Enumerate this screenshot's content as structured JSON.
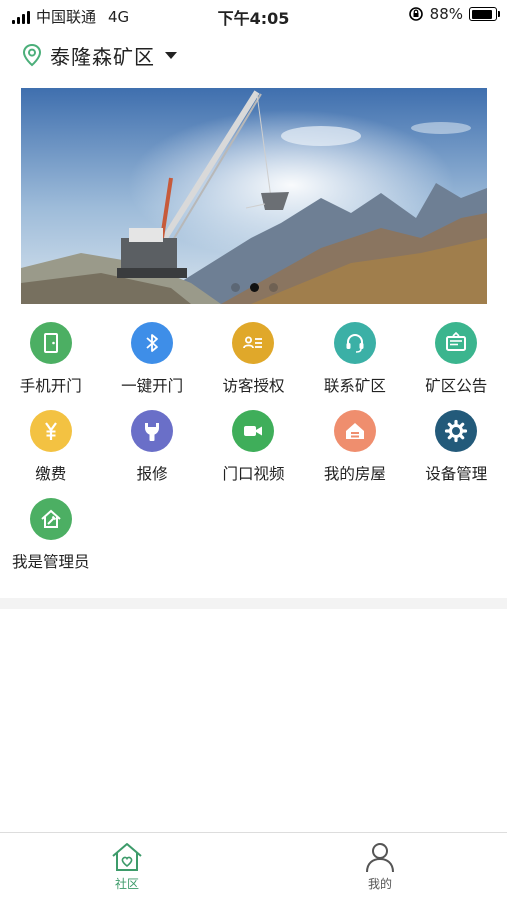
{
  "status": {
    "carrier": "中国联通",
    "network": "4G",
    "time": "下午4:05",
    "battery": "88%",
    "battery_level": 0.88
  },
  "header": {
    "location": "泰隆森矿区"
  },
  "banner": {
    "slide_count": 3,
    "active_index": 1
  },
  "grid": {
    "items": [
      {
        "label": "手机开门",
        "icon": "phone-door-icon",
        "color": "#4caf63"
      },
      {
        "label": "一键开门",
        "icon": "bluetooth-icon",
        "color": "#3e8ee8"
      },
      {
        "label": "访客授权",
        "icon": "visitor-card-icon",
        "color": "#e0a82a"
      },
      {
        "label": "联系矿区",
        "icon": "headset-icon",
        "color": "#3bb0a6"
      },
      {
        "label": "矿区公告",
        "icon": "notice-board-icon",
        "color": "#3bb58e"
      },
      {
        "label": "缴费",
        "icon": "yen-icon",
        "color": "#f3c242"
      },
      {
        "label": "报修",
        "icon": "wrench-icon",
        "color": "#6a6fc8"
      },
      {
        "label": "门口视频",
        "icon": "video-camera-icon",
        "color": "#3fae5a"
      },
      {
        "label": "我的房屋",
        "icon": "house-icon",
        "color": "#ef8e6e"
      },
      {
        "label": "设备管理",
        "icon": "gear-icon",
        "color": "#235a7a"
      },
      {
        "label": "我是管理员",
        "icon": "admin-tools-icon",
        "color": "#4caf63"
      }
    ]
  },
  "tabbar": {
    "tabs": [
      {
        "label": "社区",
        "icon": "community-home-icon",
        "active": true
      },
      {
        "label": "我的",
        "icon": "user-icon",
        "active": false
      }
    ],
    "active_color": "#3d9b6a",
    "inactive_color": "#555555"
  }
}
